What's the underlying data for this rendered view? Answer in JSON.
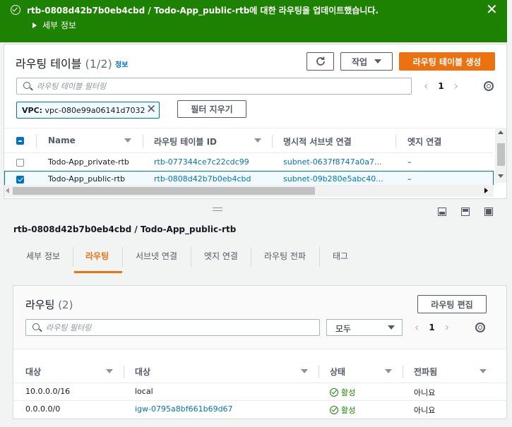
{
  "banner": {
    "message": "rtb-0808d42b7b0eb4cbd / Todo-App_public-rtb에 대한 라우팅을 업데이트했습니다.",
    "details_label": "세부 정보",
    "close_icon": "close-icon",
    "color": "#1d8102"
  },
  "table": {
    "title": "라우팅 테이블",
    "count": "(1/2)",
    "info_label": "정보",
    "action_label": "작업",
    "create_label": "라우팅 테이블 생성",
    "search_placeholder": "라우팅 테이블 필터링",
    "page": "1",
    "filter_token": {
      "key": "VPC:",
      "value": "vpc-080e99a06141d7032"
    },
    "clear_filters_label": "필터 지우기",
    "columns": [
      "Name",
      "라우팅 테이블 ID",
      "명시적 서브넷 연결",
      "엣지 연결"
    ],
    "rows": [
      {
        "name": "Todo-App_private-rtb",
        "id": "rtb-077344ce7c22cdc99",
        "subnet": "subnet-0637f8747a0a7...",
        "edge": "–",
        "selected": false
      },
      {
        "name": "Todo-App_public-rtb",
        "id": "rtb-0808d42b7b0eb4cbd",
        "subnet": "subnet-09b280e5abc40...",
        "edge": "–",
        "selected": true
      }
    ]
  },
  "detail": {
    "title": "rtb-0808d42b7b0eb4cbd / Todo-App_public-rtb",
    "tabs": [
      "세부 정보",
      "라우팅",
      "서브넷 연결",
      "엣지 연결",
      "라우팅 전파",
      "태그"
    ],
    "active_tab": "라우팅"
  },
  "routes": {
    "title": "라우팅",
    "count": "(2)",
    "edit_label": "라우팅 편집",
    "search_placeholder": "라우팅 필터링",
    "select_value": "모두",
    "page": "1",
    "columns": [
      "대상",
      "대상",
      "상태",
      "전파됨"
    ],
    "rows": [
      {
        "destination": "10.0.0.0/16",
        "target": "local",
        "status": "활성",
        "propagated": "아니요",
        "target_is_link": false
      },
      {
        "destination": "0.0.0.0/0",
        "target": "igw-0795a8bf661b69d67",
        "status": "활성",
        "propagated": "아니요",
        "target_is_link": true
      }
    ]
  },
  "colors": {
    "accent": "#ec7211",
    "link": "#0073bb",
    "success": "#1d8102"
  }
}
